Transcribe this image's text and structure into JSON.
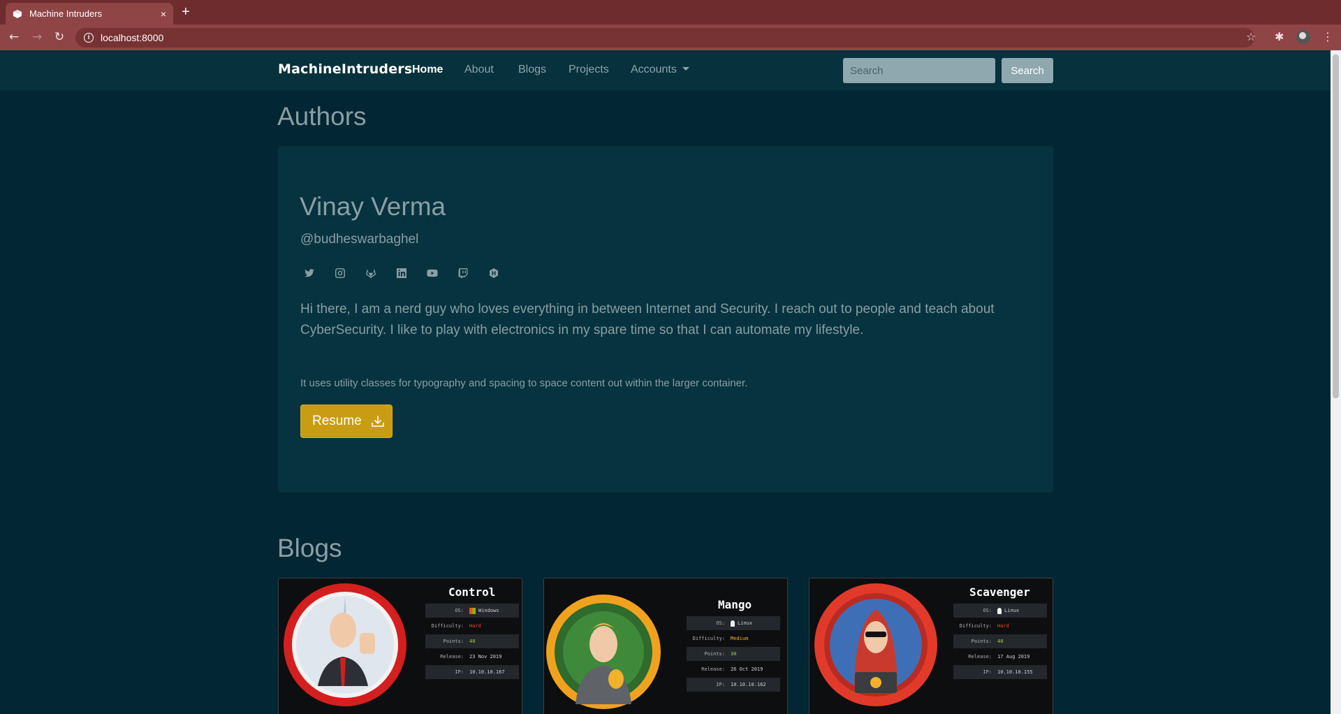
{
  "browser": {
    "tab_title": "Machine Intruders",
    "tab_close": "×",
    "new_tab": "+",
    "url": "localhost:8000",
    "back": "←",
    "forward": "→",
    "reload": "↻",
    "star": "☆",
    "extensions": "✱"
  },
  "navbar": {
    "brand": "MachineIntruders",
    "links": {
      "home": "Home",
      "about": "About",
      "blogs": "Blogs",
      "projects": "Projects",
      "accounts": "Accounts"
    },
    "search_placeholder": "Search",
    "search_button": "Search"
  },
  "authors": {
    "section_title": "Authors",
    "name": "Vinay Verma",
    "handle": "@budheswarbaghel",
    "socials": [
      "twitter-icon",
      "instagram-icon",
      "gitlab-icon",
      "linkedin-icon",
      "youtube-icon",
      "twitch-icon",
      "hackthebox-icon"
    ],
    "bio": "Hi there, I am a nerd guy who loves everything in between Internet and Security. I reach out to people and teach about CyberSecurity. I like to play with electronics in my spare time so that I can automate my lifestyle.",
    "note": "It uses utility classes for typography and spacing to space content out within the larger container.",
    "resume_label": "Resume"
  },
  "blogs": {
    "section_title": "Blogs",
    "cards": [
      {
        "name": "Control",
        "labels": {
          "os": "OS:",
          "difficulty": "Difficulty:",
          "points": "Points:",
          "release": "Release:",
          "ip": "IP:"
        },
        "os": "Windows",
        "difficulty": "Hard",
        "points": "40",
        "release": "23 Nov 2019",
        "ip": "10.10.10.167",
        "ring_color": "#d41f1f"
      },
      {
        "name": "Mango",
        "labels": {
          "os": "OS:",
          "difficulty": "Difficulty:",
          "points": "Points:",
          "release": "Release:",
          "ip": "IP:"
        },
        "os": "Linux",
        "difficulty": "Medium",
        "points": "30",
        "release": "26 Oct 2019",
        "ip": "10.10.10.162",
        "ring_color": "#f0a21e"
      },
      {
        "name": "Scavenger",
        "labels": {
          "os": "OS:",
          "difficulty": "Difficulty:",
          "points": "Points:",
          "release": "Release:",
          "ip": "IP:"
        },
        "os": "Linux",
        "difficulty": "Hard",
        "points": "40",
        "release": "17 Aug 2019",
        "ip": "10.10.10.155",
        "ring_color": "#e23a2a"
      }
    ]
  }
}
